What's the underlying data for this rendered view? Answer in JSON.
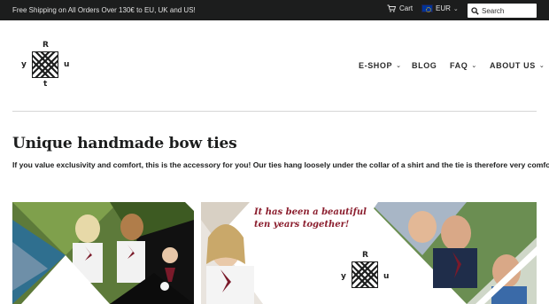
{
  "topbar": {
    "promo": "Free Shipping on All Orders Over 130€ to EU, UK and US!",
    "cart_label": "Cart",
    "currency": "EUR",
    "search_placeholder": "Search"
  },
  "logo": {
    "letters": [
      "R",
      "y",
      "u",
      "t"
    ]
  },
  "nav": {
    "items": [
      {
        "label": "E-SHOP",
        "has_dropdown": true
      },
      {
        "label": "BLOG",
        "has_dropdown": false
      },
      {
        "label": "FAQ",
        "has_dropdown": true
      },
      {
        "label": "ABOUT US",
        "has_dropdown": true
      }
    ]
  },
  "main": {
    "title": "Unique handmade bow ties",
    "intro": "If you value exclusivity and comfort, this is the accessory for you! Our ties hang loosely under the collar of a shirt and the tie is therefore very comfortable."
  },
  "banners": {
    "right_quote_line1": "It has been a beautiful",
    "right_quote_line2": "ten years together!"
  },
  "colors": {
    "topbar_bg": "#1c1d1d",
    "accent": "#8b1e2e",
    "text": "#1c1d1d"
  }
}
